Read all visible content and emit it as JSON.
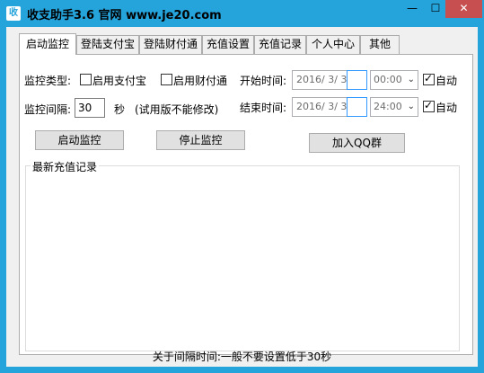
{
  "window": {
    "icon_text": "收",
    "title": "收支助手3.6 官网 www.je20.com",
    "minimize_glyph": "—",
    "maximize_glyph": "☐",
    "close_glyph": "✕",
    "accent_color": "#25a3db"
  },
  "tabs": [
    {
      "label": "启动监控",
      "active": true
    },
    {
      "label": "登陆支付宝"
    },
    {
      "label": "登陆财付通"
    },
    {
      "label": "充值设置"
    },
    {
      "label": "充值记录"
    },
    {
      "label": "个人中心"
    },
    {
      "label": "其他"
    }
  ],
  "monitor": {
    "type_label": "监控类型:",
    "alipay_label": "启用支付宝",
    "alipay_checked": false,
    "tenpay_label": "启用财付通",
    "tenpay_checked": false,
    "interval_label": "监控间隔:",
    "interval_value": "30",
    "seconds_label": "秒",
    "trial_note": "(试用版不能修改)"
  },
  "schedule": {
    "start_label": "开始时间:",
    "start_date": "2016/ 3/ 3",
    "start_time": "00:00",
    "start_auto_label": "自动",
    "start_auto_checked": true,
    "end_label": "结束时间:",
    "end_date": "2016/ 3/ 3",
    "end_time": "24:00",
    "end_auto_label": "自动",
    "end_auto_checked": true
  },
  "buttons": {
    "start": "启动监控",
    "stop": "停止监控",
    "join_qq": "加入QQ群"
  },
  "records": {
    "title": "最新充值记录"
  },
  "status_text": "关于间隔时间:一般不要设置低于30秒"
}
